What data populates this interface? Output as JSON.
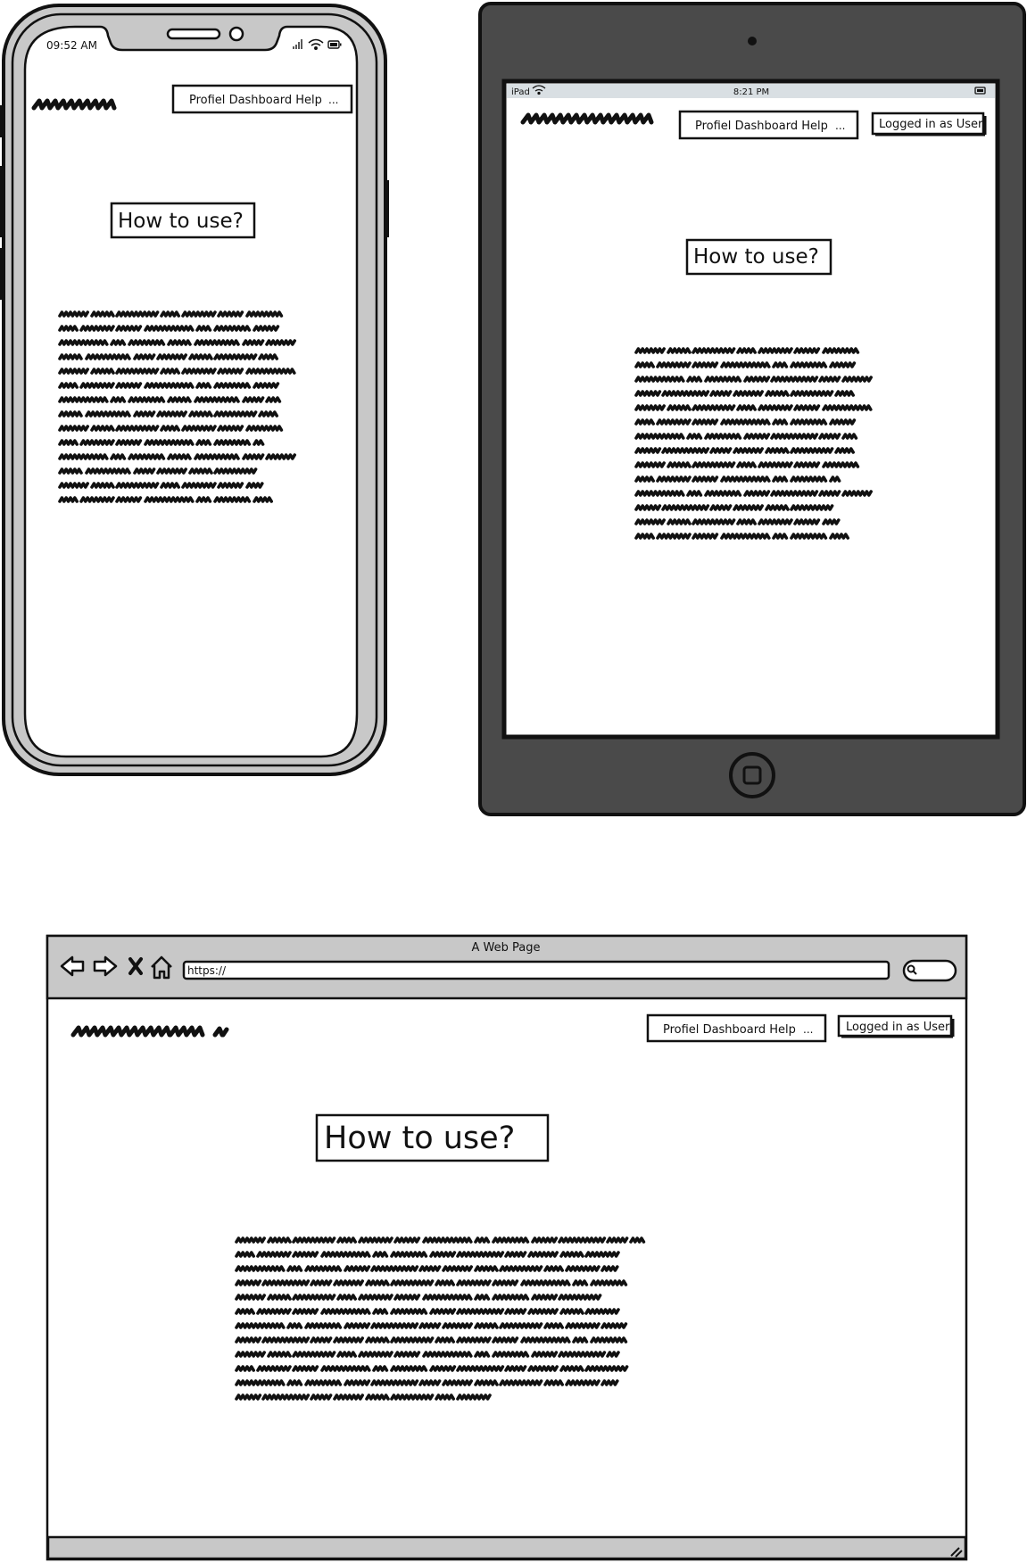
{
  "phone": {
    "time": "09:52 AM",
    "menu": {
      "items": [
        "Profiel",
        "Dashboard",
        "Help"
      ],
      "more": "..."
    },
    "heading": "How to use?"
  },
  "tablet": {
    "device": "iPad",
    "time": "8:21 PM",
    "menu": {
      "items": [
        "Profiel",
        "Dashboard",
        "Help"
      ],
      "more": "..."
    },
    "login": "Logged in as User",
    "heading": "How to use?"
  },
  "browser": {
    "title": "A Web Page",
    "url": "https://",
    "menu": {
      "items": [
        "Profiel",
        "Dashboard",
        "Help"
      ],
      "more": "..."
    },
    "login": "Logged in as User",
    "heading": "How to use?"
  },
  "icons": [
    "back-arrow-icon",
    "forward-arrow-icon",
    "close-x-icon",
    "home-icon",
    "search-icon",
    "wifi-icon",
    "battery-icon",
    "signal-icon",
    "home-button-icon",
    "camera-icon",
    "resize-grip-icon"
  ]
}
